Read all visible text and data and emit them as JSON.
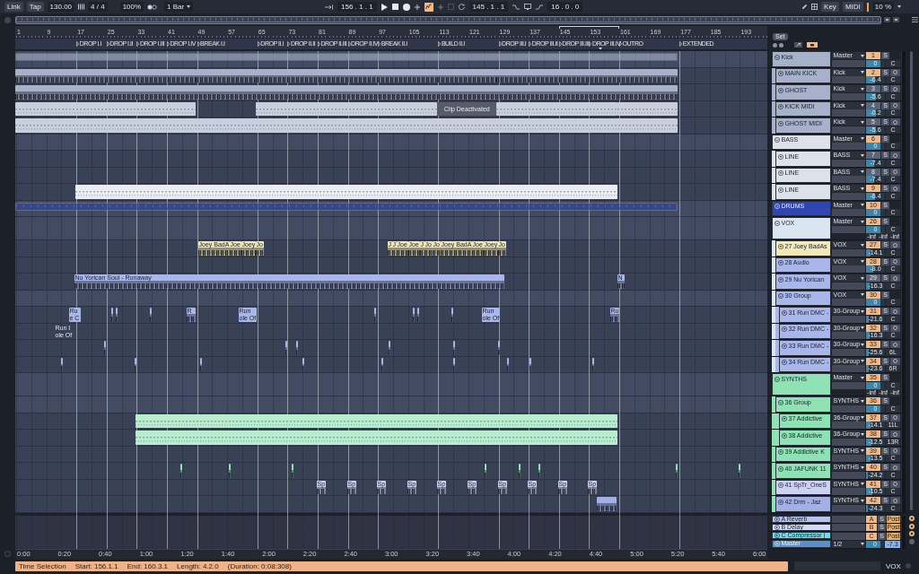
{
  "toolbar": {
    "link": "Link",
    "tap": "Tap",
    "tempo": "130.00",
    "time_signature": "4 / 4",
    "percent": "100%",
    "quantization": "1 Bar",
    "position": "156 . 1 . 1",
    "automation_arm": {
      "on": true
    },
    "loop_start": "145 . 1 . 1",
    "loop_length": "16 . 0 . 0",
    "key_map": "Key",
    "midi_map": "MIDI",
    "cpu": "10 %"
  },
  "ruler": {
    "bars": [
      "1",
      "9",
      "17",
      "25",
      "33",
      "41",
      "49",
      "57",
      "65",
      "73",
      "81",
      "89",
      "97",
      "105",
      "113",
      "121",
      "129",
      "137",
      "145",
      "153",
      "161",
      "169",
      "177",
      "185",
      "193"
    ]
  },
  "locators": [
    "DROP I.I",
    "DROP I.II",
    "DROP I.III",
    "DROP I.IV",
    "BREAK I.I",
    "DROP II.I",
    "DROP II.II",
    "DROP II.III",
    "DROP II.IV",
    "BREAK II.I",
    "BUILD II.I",
    "DROP III.I",
    "DROP III.II",
    "DROP III.III",
    "DROP III.IV",
    "OUTRO",
    "EXTENDED"
  ],
  "set_panel": {
    "title": "Set"
  },
  "tracks": [
    {
      "kind": "group",
      "name": "Kick",
      "color": "#a7b1c9",
      "expanded": true,
      "output": "Master",
      "number": "1",
      "active": true,
      "solo": "S",
      "volume": "0",
      "level": 0.78,
      "pan": "C",
      "clips": [
        {
          "kind": "overview"
        }
      ],
      "children": [
        {
          "kind": "track",
          "name": "MAIN KICK",
          "color": "#a7b1c9",
          "output": "Kick",
          "number": "2",
          "active": true,
          "solo": "S",
          "volume": "-6.4",
          "level": 0.46,
          "pan": "C",
          "clips": [
            {
              "kind": "audio"
            },
            {
              "kind": "audio"
            },
            {
              "kind": "audio"
            },
            {
              "kind": "audio"
            },
            {
              "kind": "audio"
            }
          ]
        },
        {
          "kind": "track",
          "name": "GHOST",
          "color": "#a7b1c9",
          "output": "Kick",
          "number": "3",
          "active": false,
          "solo": "S",
          "volume": "-5.6",
          "level": 0.5,
          "pan": "C",
          "clips": [
            {
              "kind": "audio"
            }
          ]
        },
        {
          "kind": "track",
          "name": "KICK MIDI",
          "color": "#a7b1c9",
          "output": "Kick",
          "number": "4",
          "active": false,
          "solo": "S",
          "volume": "-0.2",
          "level": 0.52,
          "pan": "C",
          "clips": [
            {
              "kind": "midi"
            },
            {
              "kind": "midi"
            },
            {
              "kind": "deactivated",
              "name": "Clip Deactivated"
            },
            {
              "kind": "midi"
            },
            {
              "kind": "midi"
            }
          ]
        },
        {
          "kind": "track",
          "name": "GHOST MIDI",
          "color": "#a7b1c9",
          "output": "Kick",
          "number": "5",
          "active": false,
          "solo": "S",
          "volume": "-5.6",
          "level": 0.5,
          "pan": "C",
          "clips": [
            {
              "kind": "midi"
            }
          ]
        }
      ]
    },
    {
      "kind": "group",
      "name": "BASS",
      "color": "#dde1e9",
      "expanded": true,
      "output": "Master",
      "number": "6",
      "active": true,
      "solo": "S",
      "volume": "0",
      "level": 0.78,
      "pan": "C",
      "children": [
        {
          "kind": "track",
          "name": "LINE",
          "color": "#dde1e9",
          "output": "BASS",
          "number": "7",
          "active": false,
          "solo": "S",
          "volume": "-7.4",
          "level": 0.44,
          "pan": "C"
        },
        {
          "kind": "track",
          "name": "LINE",
          "color": "#dde1e9",
          "output": "BASS",
          "number": "8",
          "active": false,
          "solo": "S",
          "volume": "-7.4",
          "level": 0.44,
          "pan": "C"
        },
        {
          "kind": "track",
          "name": "LINE",
          "color": "#dde1e9",
          "output": "BASS",
          "number": "9",
          "active": true,
          "solo": "S",
          "volume": "-6.4",
          "level": 0.46,
          "pan": "C",
          "clips": [
            {
              "kind": "midi"
            }
          ]
        }
      ]
    },
    {
      "kind": "group",
      "name": "DRUMS",
      "color": "#2f45b3",
      "expanded": false,
      "output": "Master",
      "number": "10",
      "active": true,
      "solo": "S",
      "volume": "0",
      "level": 0.78,
      "pan": "C",
      "clips": [
        {
          "kind": "overview"
        }
      ]
    },
    {
      "kind": "group",
      "name": "VOX",
      "color": "#dae5f2",
      "expanded": true,
      "output": "Master",
      "number": "26",
      "active": true,
      "solo": "S",
      "volume": "0",
      "level": 0.78,
      "pan": "C",
      "meters": [
        "-inf",
        "-inf",
        "-inf"
      ],
      "children": [
        {
          "kind": "track",
          "name": "27 Joey BadAs",
          "color": "#f2e9b6",
          "output": "VOX",
          "number": "27",
          "active": true,
          "solo": "S",
          "volume": "-14.1",
          "level": 0.22,
          "pan": "C",
          "clips": [
            {
              "kind": "audio",
              "name": "Joey BadA"
            },
            {
              "kind": "audio",
              "name": "Joe"
            },
            {
              "kind": "audio",
              "name": "Joey"
            },
            {
              "kind": "audio",
              "name": "Jo"
            },
            {
              "kind": "audio",
              "name": "J"
            },
            {
              "kind": "audio",
              "name": "J"
            },
            {
              "kind": "audio",
              "name": "Joe"
            },
            {
              "kind": "audio",
              "name": "Joe"
            },
            {
              "kind": "audio",
              "name": "J"
            },
            {
              "kind": "audio",
              "name": "Jo"
            },
            {
              "kind": "audio",
              "name": "Jo"
            },
            {
              "kind": "audio",
              "name": "Joey BadA"
            },
            {
              "kind": "audio",
              "name": "Joe"
            },
            {
              "kind": "audio",
              "name": "Joey"
            },
            {
              "kind": "audio",
              "name": "Jo"
            }
          ]
        },
        {
          "kind": "track",
          "name": "28 Audio",
          "color": "#a9b6ea",
          "output": "VOX",
          "number": "28",
          "active": true,
          "solo": "S",
          "volume": "-8.0",
          "level": 0.4,
          "pan": "C"
        },
        {
          "kind": "track",
          "name": "29 Nu Yorican",
          "color": "#a9b6ea",
          "output": "VOX",
          "number": "29",
          "active": false,
          "solo": "S",
          "volume": "-16.3",
          "level": 0.2,
          "pan": "C",
          "clips": [
            {
              "kind": "audio",
              "name": "Nu Yorican Soul - Runaway"
            },
            {
              "kind": "audio",
              "name": "N"
            }
          ]
        },
        {
          "kind": "group",
          "name": "30 Group",
          "color": "#a9b6ea",
          "expanded": true,
          "output": "VOX",
          "number": "30",
          "active": true,
          "solo": "S",
          "volume": "0",
          "level": 0.78,
          "pan": "C",
          "children": [
            {
              "kind": "track",
              "name": "31 Run DMC -",
              "color": "#a9b6ea",
              "output": "30-Group",
              "number": "31",
              "active": true,
              "solo": "S",
              "volume": "-21.6",
              "level": 0.13,
              "pan": "C",
              "clips": [
                {
                  "kind": "audio",
                  "name": "Ru",
                  "subtitle": "e C"
                },
                {
                  "kind": "audio"
                },
                {
                  "kind": "audio"
                },
                {
                  "kind": "audio"
                },
                {
                  "kind": "audio",
                  "name": "R"
                },
                {
                  "kind": "audio",
                  "name": "Run",
                  "subtitle": "ole Of"
                },
                {
                  "kind": "audio"
                },
                {
                  "kind": "audio"
                },
                {
                  "kind": "audio"
                },
                {
                  "kind": "audio"
                },
                {
                  "kind": "audio",
                  "name": "Run",
                  "subtitle": "ole Of"
                },
                {
                  "kind": "audio",
                  "name": "Ru"
                }
              ]
            },
            {
              "kind": "track",
              "name": "32 Run DMC -",
              "color": "#a9b6ea",
              "output": "30-Group",
              "number": "32",
              "active": true,
              "solo": "S",
              "volume": "-16.3",
              "level": 0.2,
              "pan": "C",
              "clips": [
                {
                  "kind": "label",
                  "name": "Run I",
                  "subtitle": "ole Of"
                }
              ]
            },
            {
              "kind": "track",
              "name": "33 Run DMC -",
              "color": "#a9b6ea",
              "output": "30-Group",
              "number": "33",
              "active": true,
              "solo": "S",
              "volume": "-25.6",
              "level": 0.16,
              "pan": "6L",
              "clips": [
                {
                  "kind": "audio"
                },
                {
                  "kind": "audio"
                },
                {
                  "kind": "audio"
                },
                {
                  "kind": "audio"
                },
                {
                  "kind": "audio"
                },
                {
                  "kind": "audio"
                }
              ]
            },
            {
              "kind": "track",
              "name": "34 Run DMC -",
              "color": "#a9b6ea",
              "output": "30-Group",
              "number": "34",
              "active": true,
              "solo": "S",
              "volume": "-23.6",
              "level": 0.12,
              "pan": "6R",
              "clips": [
                {
                  "kind": "audio"
                },
                {
                  "kind": "audio"
                },
                {
                  "kind": "audio"
                },
                {
                  "kind": "audio"
                },
                {
                  "kind": "audio"
                },
                {
                  "kind": "audio"
                },
                {
                  "kind": "audio"
                },
                {
                  "kind": "audio"
                },
                {
                  "kind": "audio"
                }
              ]
            }
          ]
        }
      ]
    },
    {
      "kind": "group",
      "name": "SYNTHS",
      "color": "#8fe2b3",
      "expanded": true,
      "output": "Master",
      "number": "35",
      "active": true,
      "solo": "S",
      "volume": "0",
      "level": 0.78,
      "pan": "C",
      "meters": [
        "-inf",
        "-inf",
        "-inf"
      ],
      "children": [
        {
          "kind": "group",
          "name": "36 Group",
          "color": "#8fe2b3",
          "expanded": true,
          "output": "SYNTHS",
          "number": "36",
          "active": true,
          "solo": "S",
          "volume": "0",
          "level": 0.78,
          "pan": "C",
          "children": [
            {
              "kind": "track",
              "name": "37 Addictive",
              "color": "#8fe2b3",
              "output": "36-Group",
              "number": "37",
              "active": true,
              "solo": "S",
              "volume": "-14.1",
              "level": 0.22,
              "pan": "11L",
              "clips": [
                {
                  "kind": "midi"
                }
              ]
            },
            {
              "kind": "track",
              "name": "38 Addictive",
              "color": "#8fe2b3",
              "output": "36-Group",
              "number": "38",
              "active": true,
              "solo": "S",
              "volume": "-12.5",
              "level": 0.27,
              "pan": "13R",
              "clips": [
                {
                  "kind": "midi"
                }
              ]
            }
          ]
        },
        {
          "kind": "track",
          "name": "39 Addictive K",
          "color": "#8fe2b3",
          "output": "SYNTHS",
          "number": "39",
          "active": true,
          "solo": "S",
          "volume": "-13.5",
          "level": 0.25,
          "pan": "C"
        },
        {
          "kind": "track",
          "name": "40 JAFUNK 11",
          "color": "#8fe2b3",
          "output": "SYNTHS",
          "number": "40",
          "active": true,
          "solo": "S",
          "volume": "-24.2",
          "level": 0.09,
          "pan": "C",
          "clips": [
            {
              "kind": "audio"
            },
            {
              "kind": "audio"
            },
            {
              "kind": "audio"
            },
            {
              "kind": "audio"
            },
            {
              "kind": "audio"
            },
            {
              "kind": "audio"
            },
            {
              "kind": "audio"
            },
            {
              "kind": "audio"
            }
          ]
        },
        {
          "kind": "track",
          "name": "41 SpTr_OneS",
          "color": "#cdd1f2",
          "output": "SYNTHS",
          "number": "41",
          "active": true,
          "solo": "S",
          "volume": "-10.5",
          "level": 0.32,
          "pan": "C",
          "clips": [
            {
              "kind": "audio",
              "name": "Sp"
            },
            {
              "kind": "audio",
              "name": "Sp"
            },
            {
              "kind": "audio",
              "name": "Sp"
            },
            {
              "kind": "audio",
              "name": "Sp"
            },
            {
              "kind": "audio",
              "name": "Sp"
            },
            {
              "kind": "audio",
              "name": "Sp"
            },
            {
              "kind": "audio",
              "name": "Sp"
            },
            {
              "kind": "audio",
              "name": "Sp"
            },
            {
              "kind": "audio",
              "name": "Sp"
            },
            {
              "kind": "audio",
              "name": "Sp"
            }
          ]
        },
        {
          "kind": "track",
          "name": "42 Drm - Jaz",
          "color": "#a3b0e6",
          "output": "SYNTHS",
          "number": "42",
          "active": true,
          "solo": "S",
          "volume": "-24.3",
          "level": 0.09,
          "pan": "C",
          "clips": [
            {
              "kind": "audio"
            }
          ]
        }
      ]
    }
  ],
  "returns": [
    {
      "kind": "return",
      "name": "A Reverb",
      "color": "#b5c3f1",
      "letter": "A",
      "active": true,
      "solo": "S",
      "post": "Post"
    },
    {
      "kind": "return",
      "name": "B Delay",
      "color": "#d5dbf6",
      "letter": "B",
      "active": true,
      "solo": "S",
      "post": "Post"
    },
    {
      "kind": "return",
      "name": "C Compressor |",
      "color": "#74dce6",
      "letter": "C",
      "active": true,
      "solo": "S",
      "post": "Post"
    },
    {
      "kind": "master",
      "name": "Master",
      "color": "#5791c9",
      "output": "1/2",
      "volume": "0",
      "level": 0.78,
      "cue": "-7.3"
    }
  ],
  "time_ruler": [
    "0:00",
    "0:20",
    "0:40",
    "1:00",
    "1:20",
    "1:40",
    "2:00",
    "2:20",
    "2:40",
    "3:00",
    "3:20",
    "3:40",
    "4:00",
    "4:20",
    "4:40",
    "5:00",
    "5:20",
    "5:40",
    "6:00"
  ],
  "status_bar": {
    "mode": "Time Selection",
    "start": "Start: 156.1.1",
    "end": "End: 160.3.1",
    "length": "Length: 4.2.0",
    "duration": "(Duration: 0:08:308)",
    "track": "VOX"
  }
}
